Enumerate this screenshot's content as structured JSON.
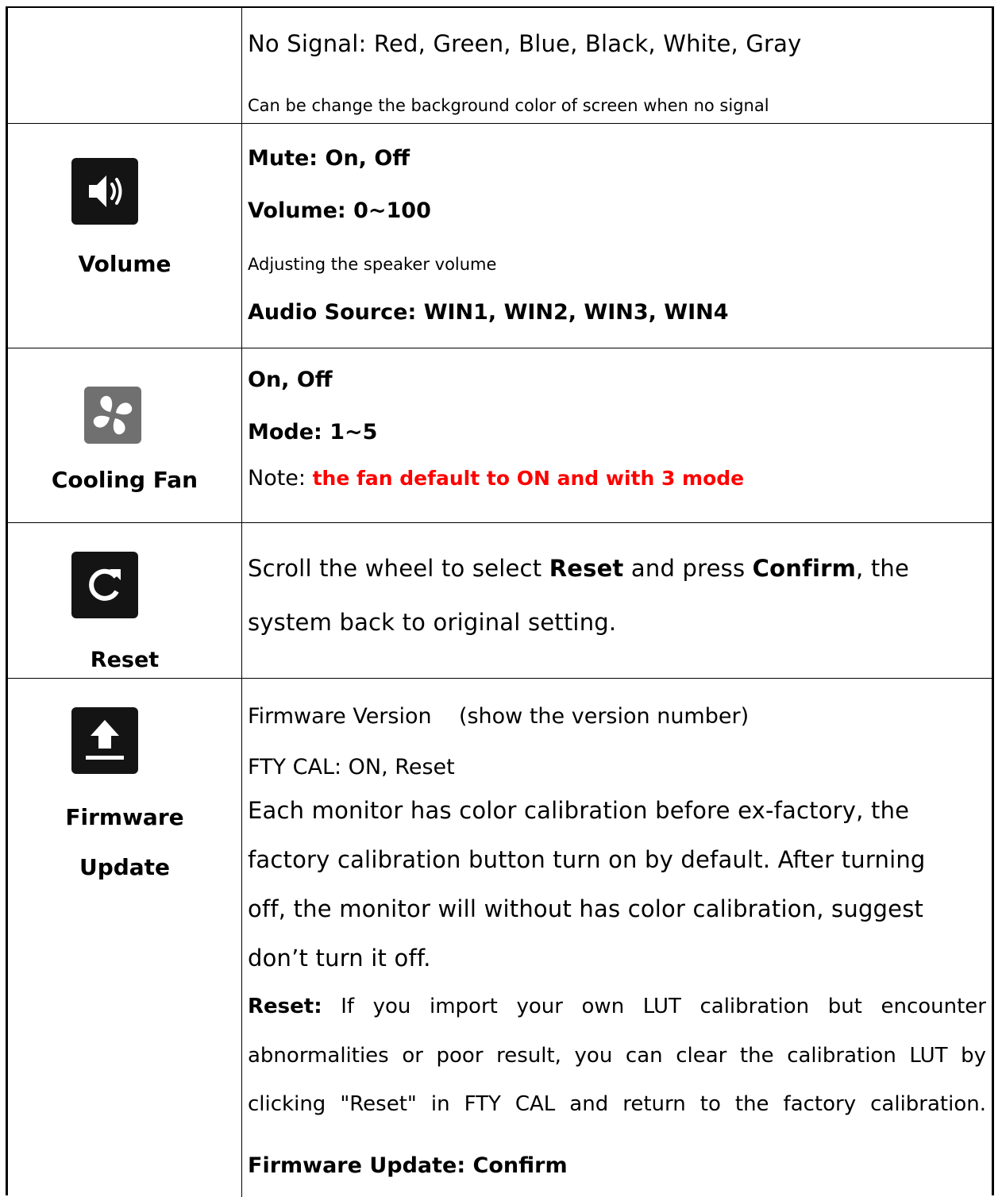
{
  "rows": [
    {
      "label": "",
      "lines": [
        "No Signal: Red, Green, Blue, Black, White, Gray",
        "Can be change the background color of screen when no signal"
      ]
    },
    {
      "icon": "speaker-icon",
      "label": "Volume",
      "lines": [
        "Mute: On, Off",
        "Volume: 0~100",
        "Adjusting the speaker volume",
        "Audio Source: WIN1, WIN2, WIN3, WIN4"
      ]
    },
    {
      "icon": "fan-icon",
      "label": "Cooling Fan",
      "lines": [
        "On, Off",
        "Mode: 1~5"
      ],
      "note_prefix": "Note: ",
      "note_highlight": "the fan default to ON and with 3 mode",
      "note_color": "#ff0000"
    },
    {
      "icon": "reset-icon",
      "label": "Reset",
      "text_1": "Scroll the wheel to select ",
      "bold_1": "Reset",
      "text_2": " and press ",
      "bold_2": "Confirm",
      "text_3": ", the",
      "line_2": "system back to original setting."
    },
    {
      "icon": "upload-icon",
      "label_1": "Firmware",
      "label_2": "Update",
      "version_line": "Firmware Version    (show the version number)",
      "fty_line": "FTY CAL: ON, Reset",
      "calibration_lines": [
        "Each monitor has color calibration before ex-factory, the",
        "factory calibration button turn on by default. After turning",
        "off, the monitor will without has color calibration, suggest",
        "don’t turn it off."
      ],
      "reset_bold": "Reset:",
      "reset_lines": [
        " If you import your own LUT calibration but encounter",
        "abnormalities or poor result, you can clear the calibration LUT by",
        "clicking \"Reset\" in FTY CAL and return to the factory calibration."
      ],
      "confirm_line": "Firmware Update: Confirm"
    }
  ]
}
